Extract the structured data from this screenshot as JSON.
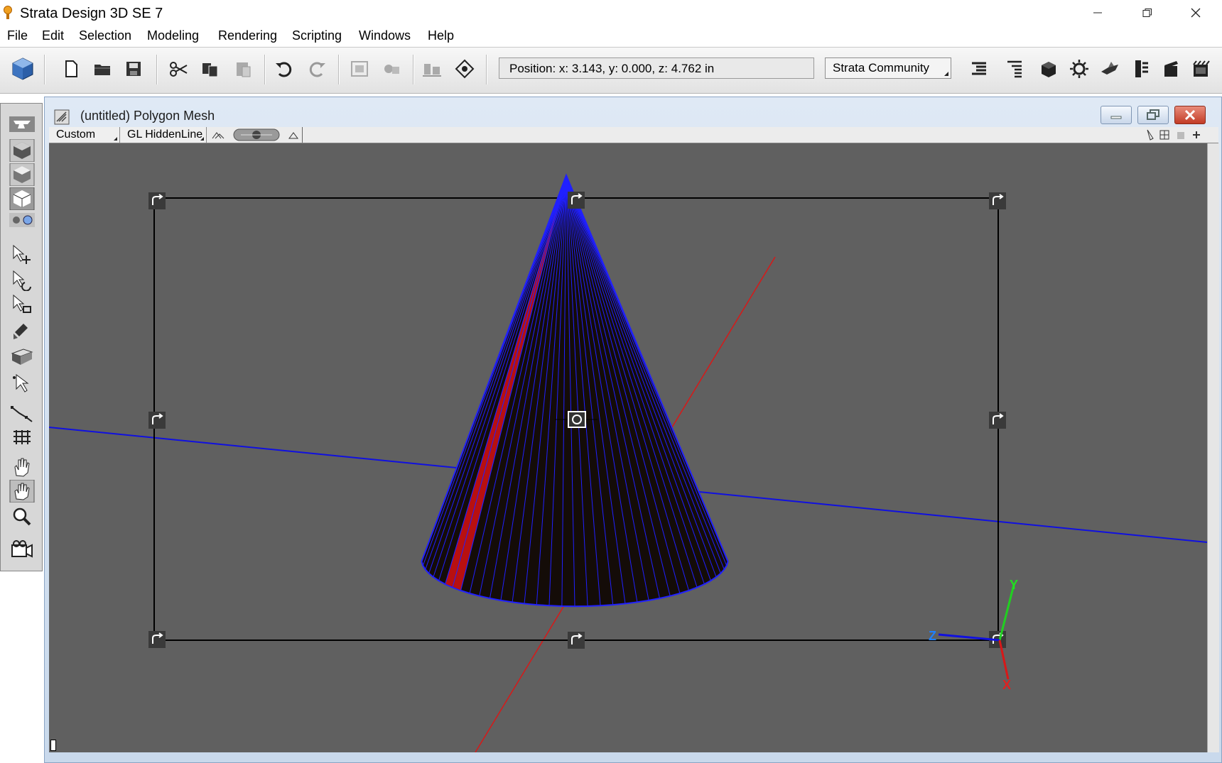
{
  "window": {
    "title": "Strata Design 3D SE 7",
    "minimize_icon": "minimize-icon",
    "maximize_icon": "restore-icon",
    "close_icon": "close-icon"
  },
  "menu": [
    "File",
    "Edit",
    "Selection",
    "Modeling",
    "Rendering",
    "Scripting",
    "Windows",
    "Help"
  ],
  "toolbar": {
    "position_readout": "Position:  x: 3.143,  y: 0.000,  z: 4.762 in",
    "workspace": "Strata Community",
    "icons": [
      "strata-cube-icon",
      "new-file-icon",
      "open-folder-icon",
      "save-icon",
      "cut-icon",
      "copy-icon",
      "paste-icon",
      "undo-icon",
      "redo-icon",
      "group-icon",
      "ungroup-icon",
      "align-icon",
      "snap-icon",
      "list-icon",
      "outline-icon",
      "object-icon",
      "lights-icon",
      "render-icon",
      "animation-icon",
      "clapper-icon",
      "movie-icon"
    ]
  },
  "palette": {
    "icons": [
      "anvil-icon",
      "cube-shaded-icon",
      "cube-wire-icon",
      "cube-preview-icon",
      "view-toggle-icon",
      "move-icon",
      "rotate-icon",
      "scale-icon",
      "paint-icon",
      "extrude-icon",
      "pointer-icon",
      "path-icon",
      "grid-icon",
      "hand-icon",
      "pan-icon",
      "zoom-icon",
      "camera-icon"
    ]
  },
  "document": {
    "title": "(untitled) Polygon Mesh",
    "view_select": "Custom",
    "render_mode": "GL HiddenLine",
    "axis_labels": {
      "y": "Y",
      "z": "Z",
      "x": "X"
    },
    "colors": {
      "viewport_bg": "#606060",
      "grid": "#9ab0d8",
      "x_axis": "#d81818",
      "z_axis": "#1010e0",
      "cone_fill": "#140c08",
      "cone_edge": "#2020ff",
      "selected_face": "#b81010"
    }
  }
}
